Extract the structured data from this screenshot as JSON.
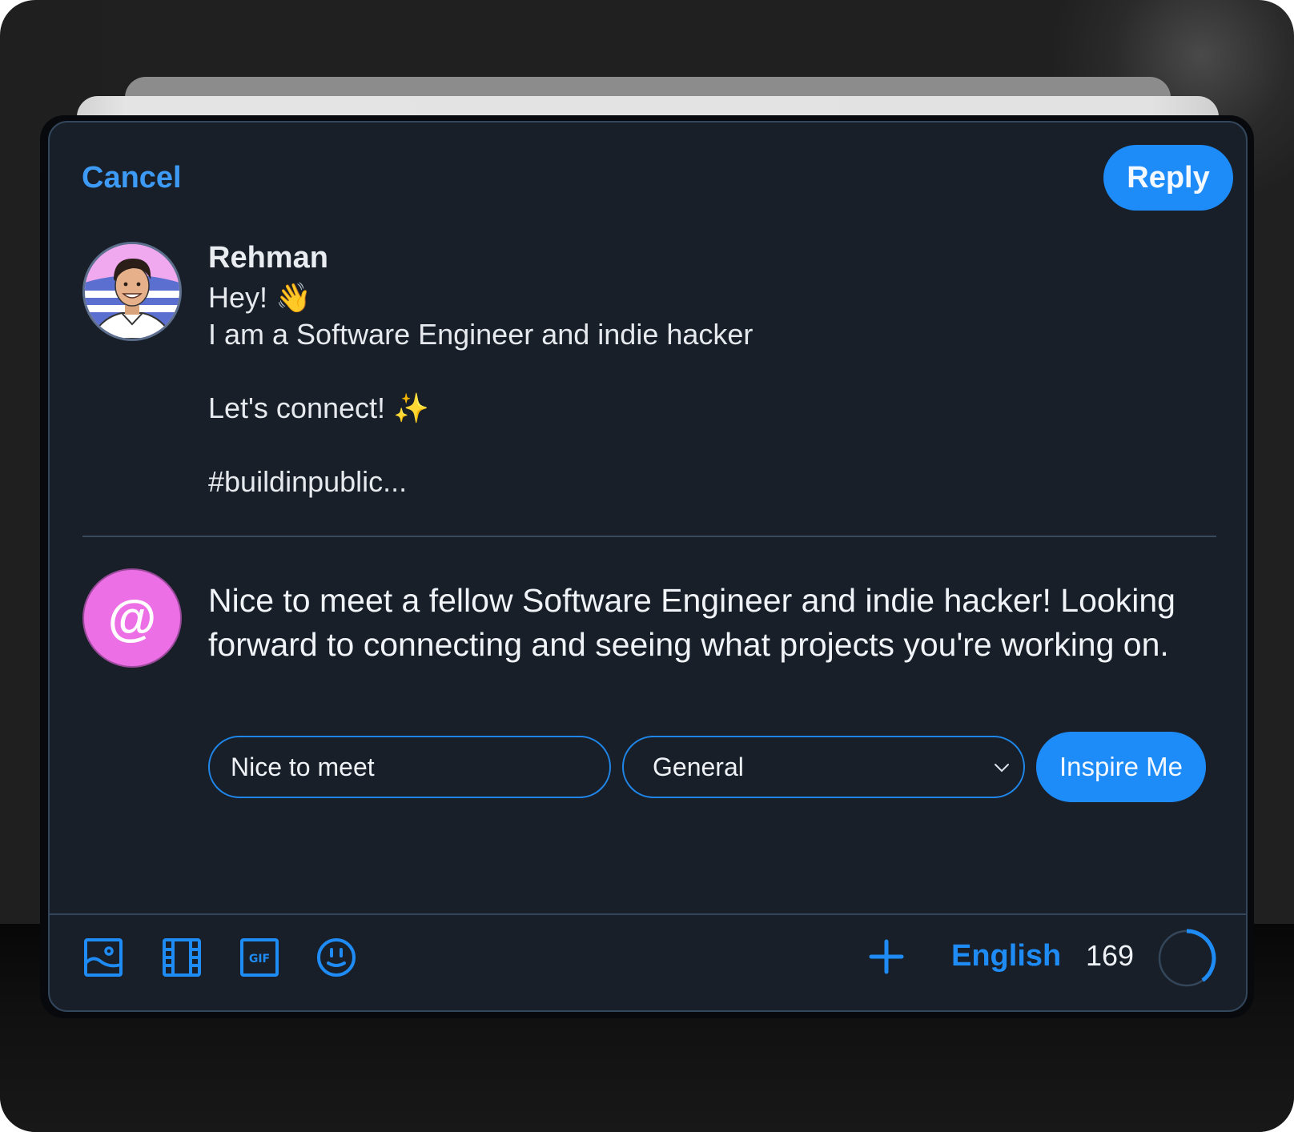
{
  "header": {
    "cancel_label": "Cancel",
    "reply_label": "Reply"
  },
  "original_post": {
    "author": "Rehman",
    "avatar": "profile-photo-illustration",
    "text": "Hey! 👋\nI am a Software Engineer and indie hacker\n\nLet's connect! ✨\n\n#buildinpublic..."
  },
  "generated_reply": {
    "avatar_icon": "at-sign-icon",
    "avatar_glyph": "@",
    "text": "Nice to meet a fellow Software Engineer and indie hacker! Looking forward to connecting and seeing what projects you're working on."
  },
  "controls": {
    "prompt_input_value": "Nice to meet",
    "tone_selected": "General",
    "inspire_label": "Inspire Me"
  },
  "toolbar": {
    "icons": [
      "image-icon",
      "video-icon",
      "gif-icon",
      "emoji-icon"
    ],
    "add_icon": "plus-icon",
    "language": "English",
    "chars_remaining": "169",
    "char_progress": 0.4
  },
  "colors": {
    "accent": "#1d8cf8",
    "card_bg": "#181f28",
    "bot_avatar": "#ec6fe6"
  }
}
